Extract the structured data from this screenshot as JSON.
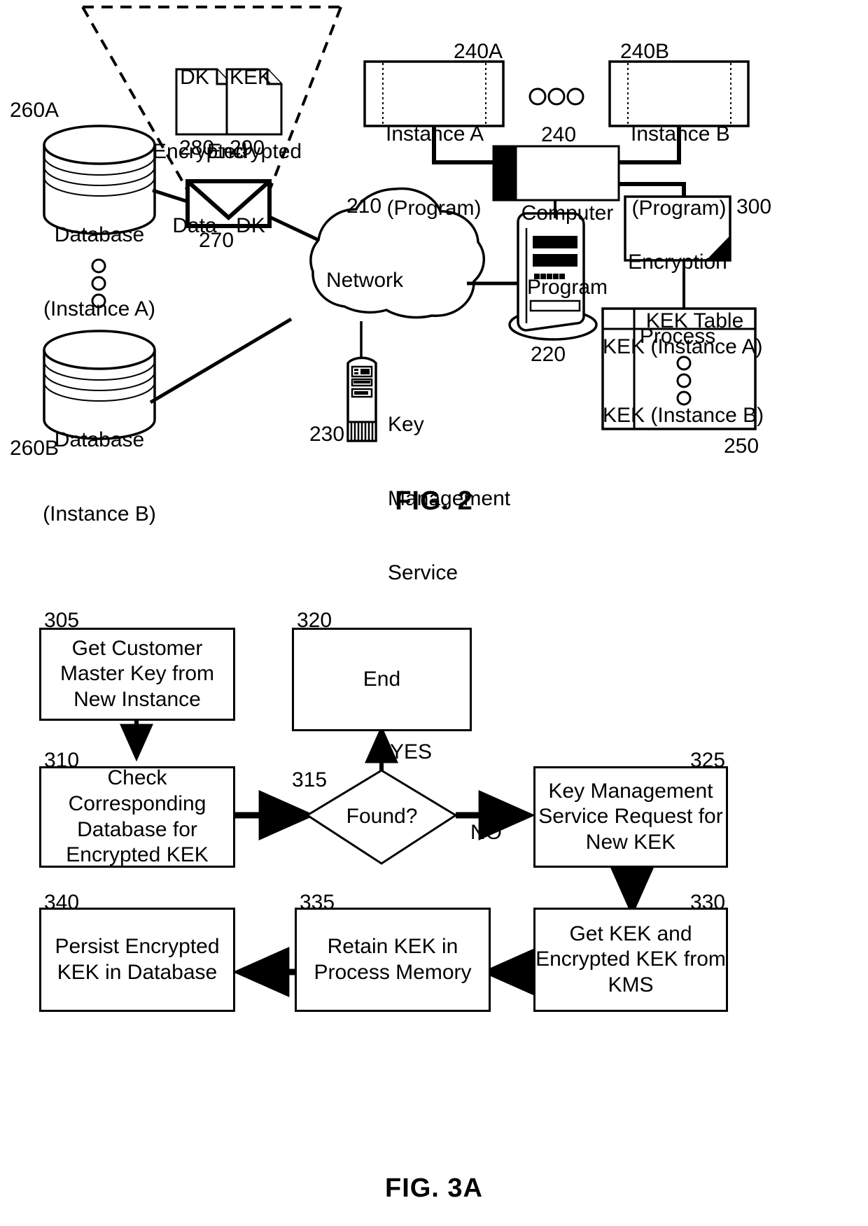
{
  "figure2": {
    "caption": "FIG. 2",
    "callout": {
      "doc1": {
        "title_line1": "DK",
        "title_line2": "Encrypted",
        "title_line3": "Data",
        "ref": "280"
      },
      "doc2": {
        "title_line1": "KEK",
        "title_line2": "Encrypted",
        "title_line3": "DK",
        "ref": "290"
      }
    },
    "envelope": {
      "ref": "270",
      "name": "message-envelope"
    },
    "databases": [
      {
        "label_line1": "Database",
        "label_line2": "(Instance A)",
        "ref": "260A"
      },
      {
        "label_line1": "Database",
        "label_line2": "(Instance B)",
        "ref": "260B"
      }
    ],
    "network": {
      "label": "Network",
      "ref": "210"
    },
    "server": {
      "ref": "220"
    },
    "kms": {
      "label_line1": "Key",
      "label_line2": "Management",
      "label_line3": "Service",
      "ref": "230"
    },
    "instances": [
      {
        "label_line1": "Instance A",
        "label_line2": "(Program)",
        "ref": "240A"
      },
      {
        "label_line1": "Instance B",
        "label_line2": "(Program)",
        "ref": "240B"
      }
    ],
    "computer_program": {
      "label_line1": "Computer",
      "label_line2": "Program",
      "ref": "240"
    },
    "encryption_process": {
      "label_line1": "Encryption",
      "label_line2": "Process",
      "ref": "300"
    },
    "kek_table": {
      "header": "KEK Table",
      "rows": [
        "KEK (Instance A)",
        "KEK (Instance B)"
      ],
      "ref": "250"
    }
  },
  "figure3a": {
    "caption": "FIG. 3A",
    "nodes": {
      "n305": {
        "ref": "305",
        "text": "Get Customer\nMaster Key from\nNew Instance"
      },
      "n310": {
        "ref": "310",
        "text": "Check\nCorresponding\nDatabase for\nEncrypted KEK"
      },
      "n315": {
        "ref": "315",
        "text": "Found?"
      },
      "n320": {
        "ref": "320",
        "text": "End"
      },
      "n325": {
        "ref": "325",
        "text": "Key Management\nService Request for\nNew KEK"
      },
      "n330": {
        "ref": "330",
        "text": "Get KEK and\nEncrypted KEK from\nKMS"
      },
      "n335": {
        "ref": "335",
        "text": "Retain KEK in\nProcess Memory"
      },
      "n340": {
        "ref": "340",
        "text": "Persist Encrypted\nKEK in Database"
      }
    },
    "edge_labels": {
      "yes": "YES",
      "no": "NO"
    }
  },
  "colors": {
    "ink": "#000000",
    "paper": "#ffffff"
  }
}
